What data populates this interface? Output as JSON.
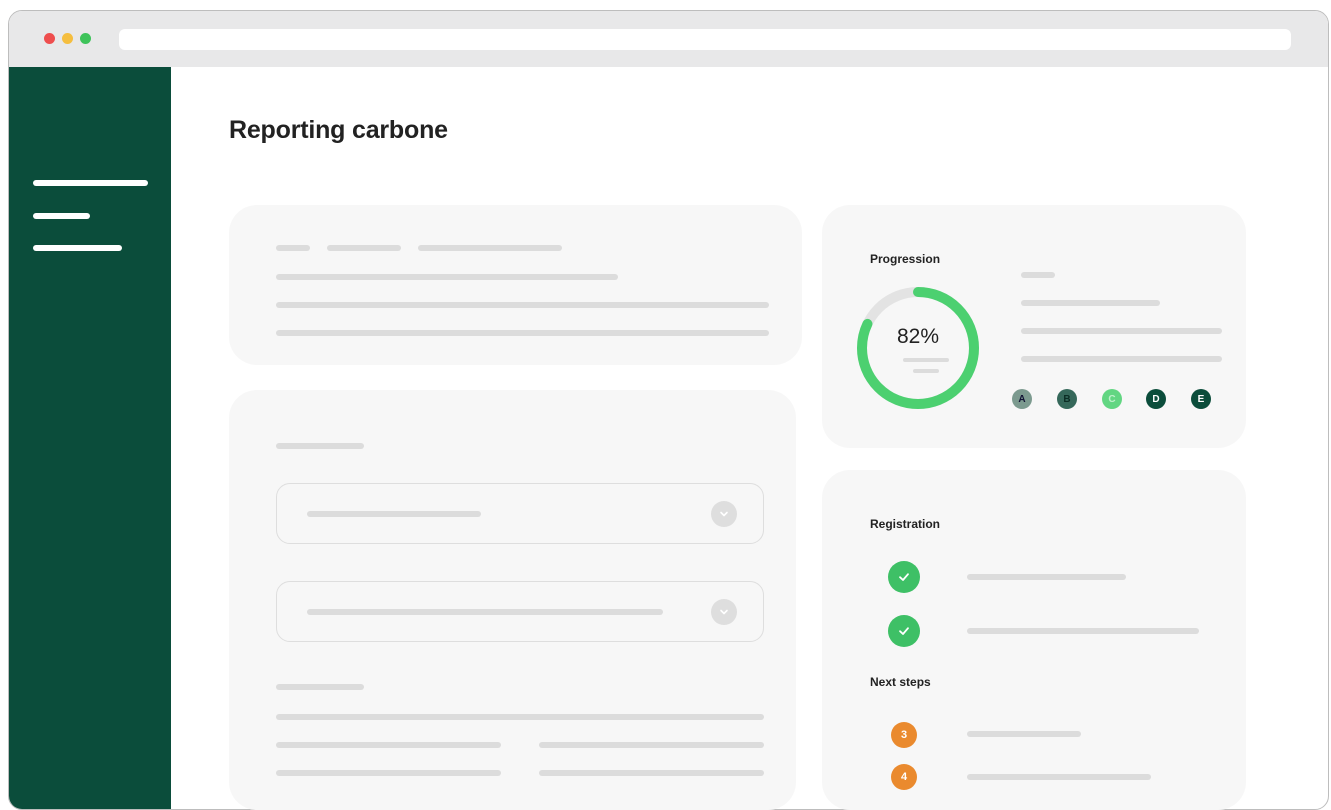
{
  "page": {
    "title": "Reporting carbone"
  },
  "progression": {
    "label": "Progression",
    "percent_text": "82%",
    "percent": 82,
    "grades": [
      "A",
      "B",
      "C",
      "D",
      "E"
    ]
  },
  "registration": {
    "label": "Registration",
    "next_steps_label": "Next steps",
    "steps": [
      "3",
      "4"
    ]
  },
  "icons": [
    "close-dot",
    "minimize-dot",
    "maximize-dot",
    "hamburger-menu-icon",
    "chevron-down-icon",
    "check-icon"
  ],
  "colors": {
    "sidebar": "#0b4d3b",
    "accent_green": "#3ec066",
    "gauge_green": "#4cd070",
    "step_orange": "#ea8a2e"
  }
}
